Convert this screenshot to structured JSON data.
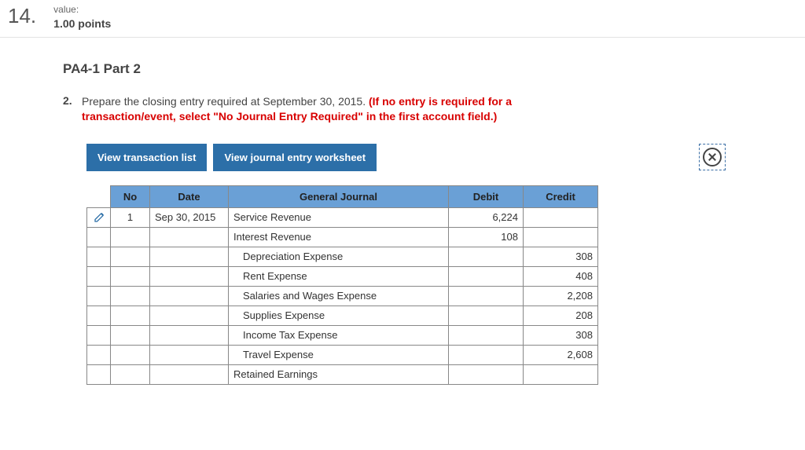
{
  "header": {
    "question_number": "14.",
    "value_label": "value:",
    "points": "1.00 points"
  },
  "part_title": "PA4-1 Part 2",
  "instruction": {
    "number": "2.",
    "text_black": "Prepare the closing entry required at September 30, 2015. ",
    "text_red": "(If no entry is required for a transaction/event, select \"No Journal Entry Required\" in the first account field.)"
  },
  "buttons": {
    "view_trans": "View transaction list",
    "view_worksheet": "View journal entry worksheet"
  },
  "table": {
    "headers": {
      "no": "No",
      "date": "Date",
      "gj": "General Journal",
      "debit": "Debit",
      "credit": "Credit"
    },
    "rows": [
      {
        "edit": true,
        "no": "1",
        "date": "Sep 30, 2015",
        "account": "Service Revenue",
        "indent": 0,
        "debit": "6,224",
        "credit": ""
      },
      {
        "edit": false,
        "no": "",
        "date": "",
        "account": "Interest Revenue",
        "indent": 0,
        "debit": "108",
        "credit": ""
      },
      {
        "edit": false,
        "no": "",
        "date": "",
        "account": "Depreciation Expense",
        "indent": 1,
        "debit": "",
        "credit": "308"
      },
      {
        "edit": false,
        "no": "",
        "date": "",
        "account": "Rent Expense",
        "indent": 1,
        "debit": "",
        "credit": "408"
      },
      {
        "edit": false,
        "no": "",
        "date": "",
        "account": "Salaries and Wages Expense",
        "indent": 1,
        "debit": "",
        "credit": "2,208"
      },
      {
        "edit": false,
        "no": "",
        "date": "",
        "account": "Supplies Expense",
        "indent": 1,
        "debit": "",
        "credit": "208"
      },
      {
        "edit": false,
        "no": "",
        "date": "",
        "account": "Income Tax Expense",
        "indent": 1,
        "debit": "",
        "credit": "308"
      },
      {
        "edit": false,
        "no": "",
        "date": "",
        "account": "Travel Expense",
        "indent": 1,
        "debit": "",
        "credit": "2,608"
      },
      {
        "edit": false,
        "no": "",
        "date": "",
        "account": "Retained Earnings",
        "indent": 0,
        "debit": "",
        "credit": ""
      }
    ]
  }
}
